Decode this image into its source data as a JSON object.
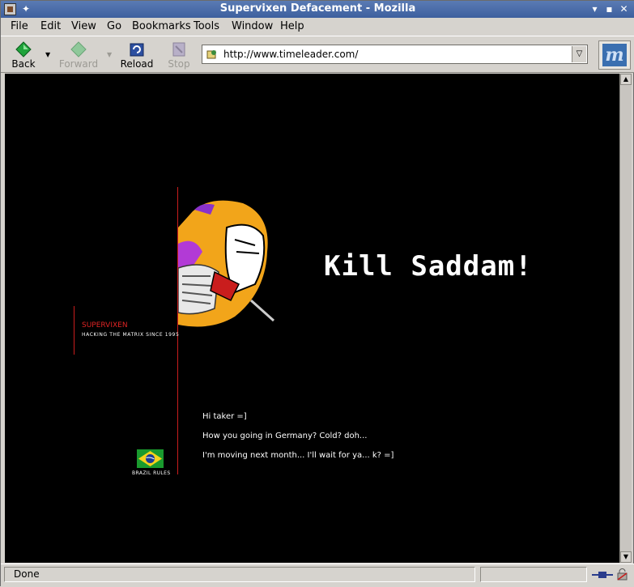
{
  "window": {
    "title": "Supervixen Defacement - Mozilla"
  },
  "menu": [
    {
      "label": "File"
    },
    {
      "label": "Edit"
    },
    {
      "label": "View"
    },
    {
      "label": "Go"
    },
    {
      "label": "Bookmarks"
    },
    {
      "label": "Tools"
    },
    {
      "label": "Window"
    },
    {
      "label": "Help"
    }
  ],
  "toolbar": {
    "back_label": "Back",
    "forward_label": "Forward",
    "reload_label": "Reload",
    "stop_label": "Stop",
    "url": "http://www.timeleader.com/"
  },
  "page": {
    "headline": "Kill Saddam!",
    "brand": "SUPERVIXEN",
    "tagline": "HACKING THE MATRIX SINCE 1995",
    "messages": [
      "Hi taker =]",
      "How you going in Germany? Cold? doh...",
      "I'm moving next month... I'll wait for ya... k? =]"
    ],
    "flag_label": "BRAZIL RULES"
  },
  "status": {
    "text": "Done"
  },
  "colors": {
    "accent_red": "#c91d1d",
    "page_bg": "#000000",
    "titlebar": "#3d5f9e"
  }
}
